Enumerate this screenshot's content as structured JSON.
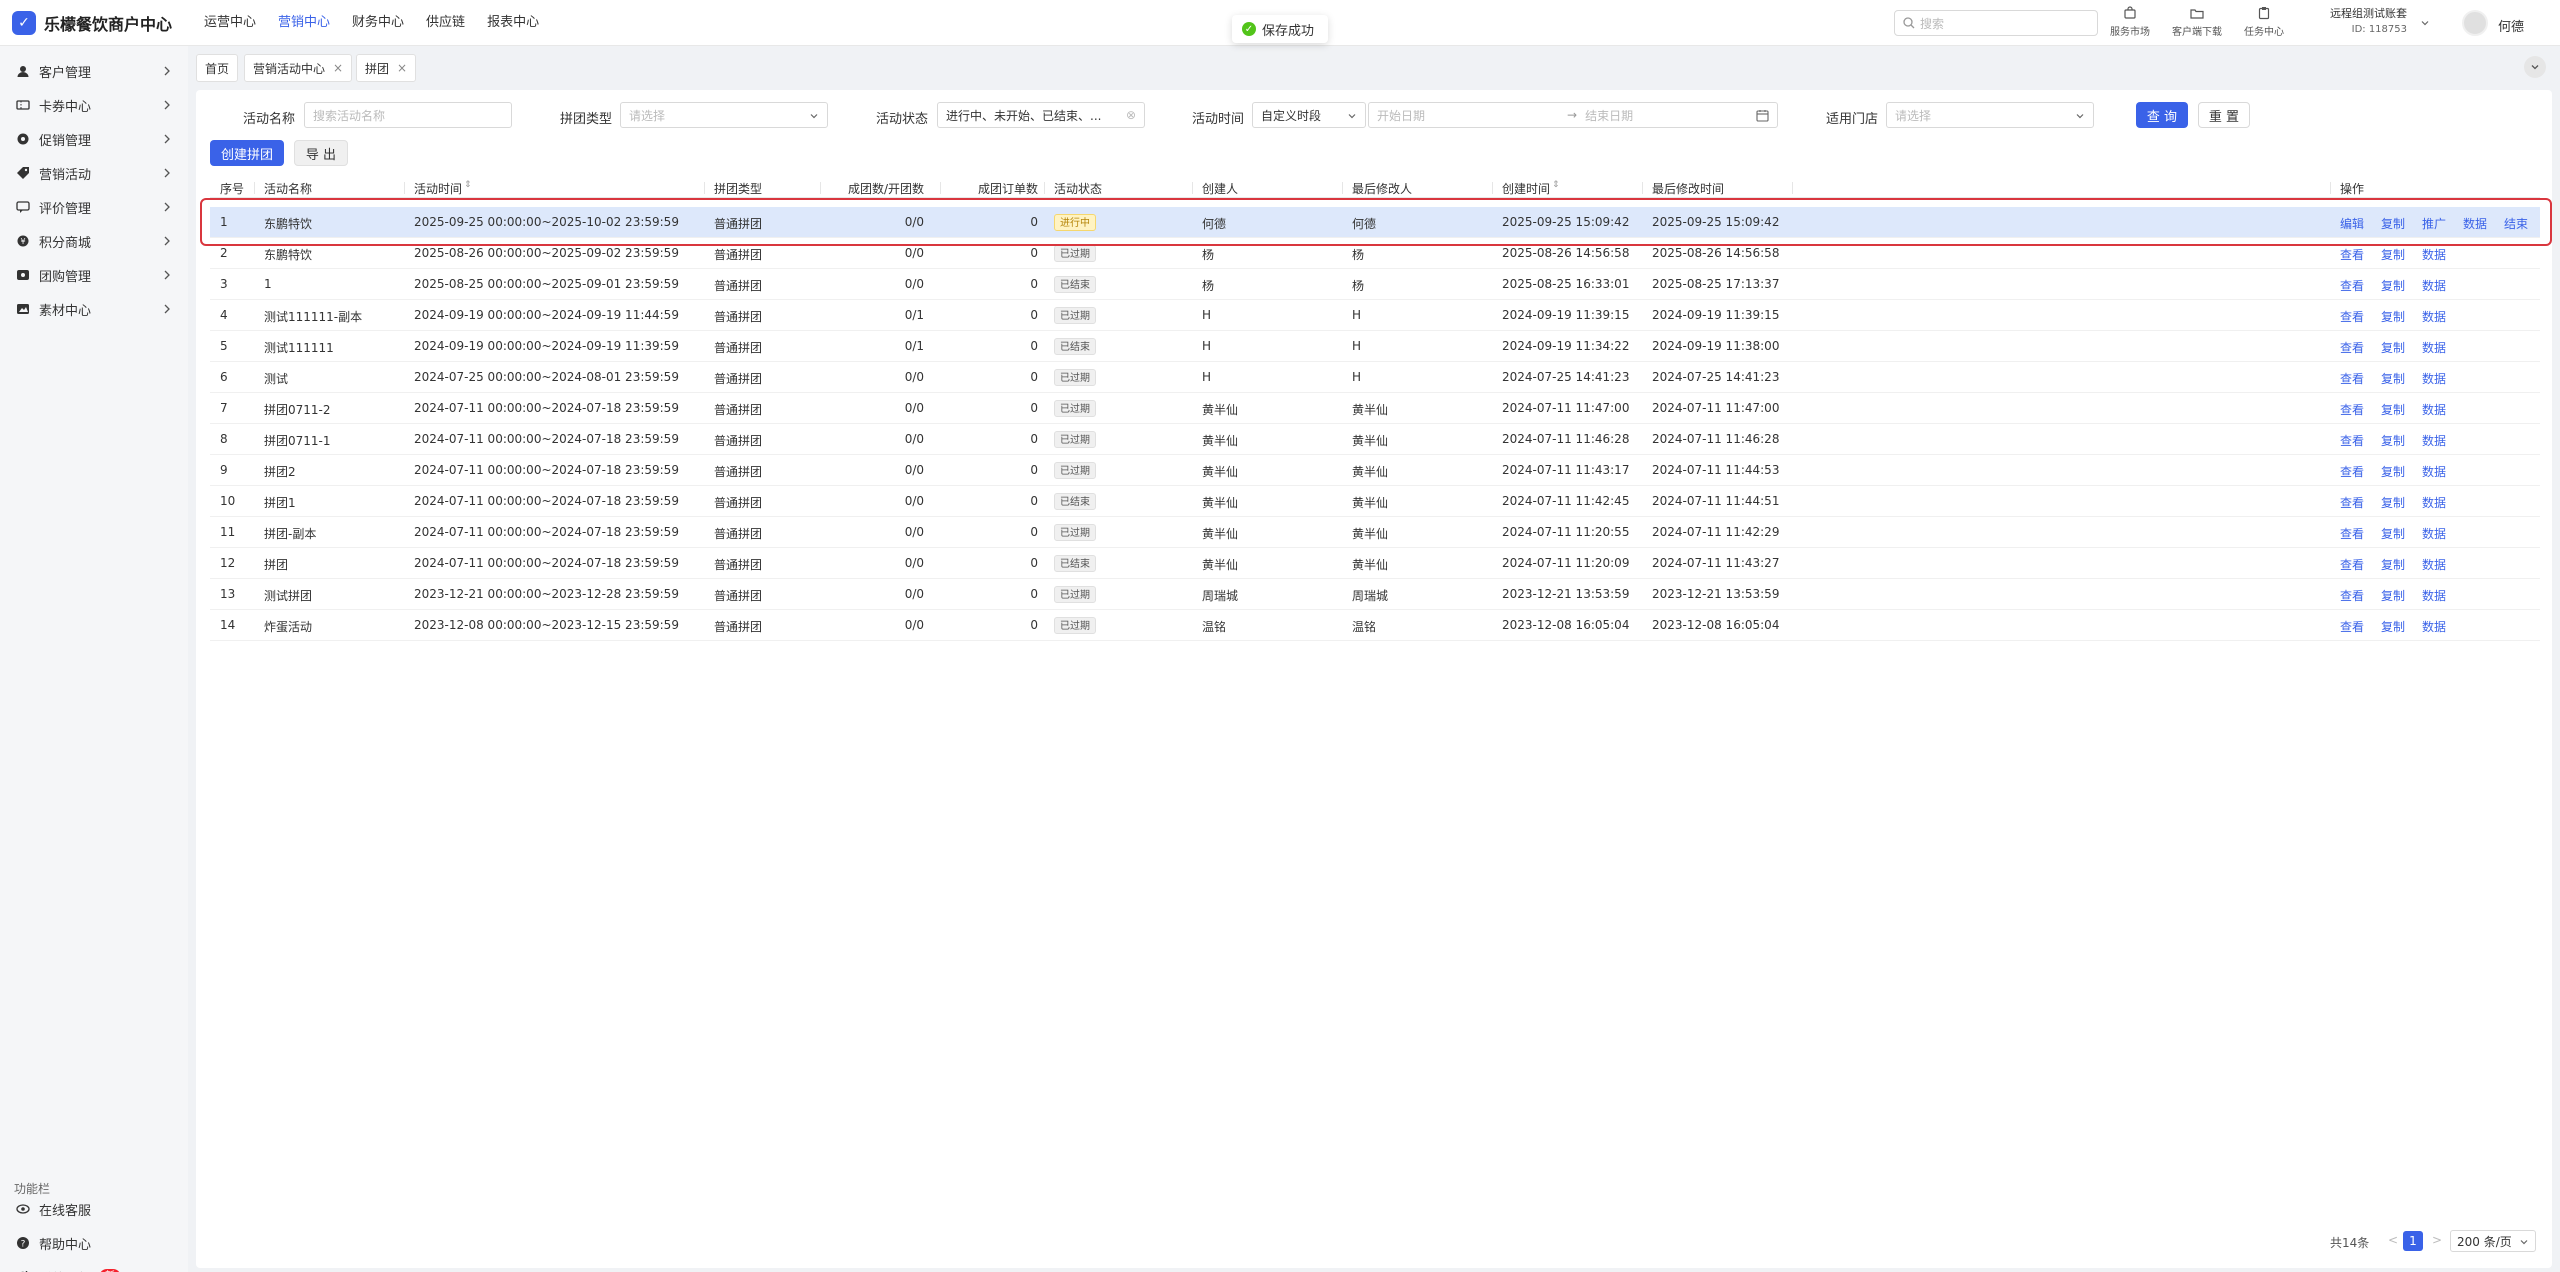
{
  "app": {
    "title": "乐檬餐饮商户中心",
    "logo_char": "✓"
  },
  "topnav": [
    {
      "label": "运营中心",
      "active": false
    },
    {
      "label": "营销中心",
      "active": true
    },
    {
      "label": "财务中心",
      "active": false
    },
    {
      "label": "供应链",
      "active": false
    },
    {
      "label": "报表中心",
      "active": false
    }
  ],
  "toast": {
    "text": "保存成功"
  },
  "search": {
    "placeholder": "搜索"
  },
  "tools": [
    {
      "label": "服务市场",
      "icon": "shop-icon"
    },
    {
      "label": "客户端下载",
      "icon": "folder-icon"
    },
    {
      "label": "任务中心",
      "icon": "clipboard-icon"
    }
  ],
  "account": {
    "name": "远程组测试账套",
    "id": "ID: 118753",
    "user": "何德"
  },
  "sidebar": {
    "items": [
      {
        "label": "客户管理",
        "icon": "user-icon"
      },
      {
        "label": "卡券中心",
        "icon": "ticket-icon"
      },
      {
        "label": "促销管理",
        "icon": "gear-icon"
      },
      {
        "label": "营销活动",
        "icon": "tag-icon"
      },
      {
        "label": "评价管理",
        "icon": "comment-icon"
      },
      {
        "label": "积分商城",
        "icon": "coin-icon"
      },
      {
        "label": "团购管理",
        "icon": "group-icon"
      },
      {
        "label": "素材中心",
        "icon": "image-icon"
      }
    ],
    "func_title": "功能栏",
    "func_items": [
      {
        "label": "在线客服",
        "icon": "eye-icon"
      },
      {
        "label": "帮助中心",
        "icon": "help-icon"
      },
      {
        "label": "系统更新",
        "icon": "refresh-icon",
        "badge": "新"
      }
    ]
  },
  "tabs": [
    {
      "label": "首页",
      "closable": false
    },
    {
      "label": "营销活动中心",
      "closable": true
    },
    {
      "label": "拼团",
      "closable": true
    }
  ],
  "filters": {
    "name_label": "活动名称",
    "name_placeholder": "搜索活动名称",
    "type_label": "拼团类型",
    "type_placeholder": "请选择",
    "status_label": "活动状态",
    "status_value": "进行中、未开始、已结束、...",
    "time_label": "活动时间",
    "time_mode": "自定义时段",
    "start_placeholder": "开始日期",
    "end_placeholder": "结束日期",
    "store_label": "适用门店",
    "store_placeholder": "请选择",
    "query_label": "查 询",
    "reset_label": "重 置"
  },
  "actions": {
    "create_label": "创建拼团",
    "export_label": "导 出"
  },
  "table": {
    "columns": [
      "序号",
      "活动名称",
      "活动时间",
      "拼团类型",
      "成团数/开团数",
      "成团订单数",
      "活动状态",
      "创建人",
      "最后修改人",
      "创建时间",
      "最后修改时间",
      "操作"
    ],
    "rows": [
      {
        "no": "1",
        "name": "东鹏特饮",
        "time": "2025-09-25 00:00:00~2025-10-02 23:59:59",
        "type": "普通拼团",
        "ratio": "0/0",
        "orders": "0",
        "status": "进行中",
        "status_kind": "active",
        "creator": "何德",
        "modifier": "何德",
        "created": "2025-09-25 15:09:42",
        "modified": "2025-09-25 15:09:42",
        "ops": [
          "编辑",
          "复制",
          "推广",
          "数据",
          "结束"
        ],
        "highlight": true
      },
      {
        "no": "2",
        "name": "东鹏特饮",
        "time": "2025-08-26 00:00:00~2025-09-02 23:59:59",
        "type": "普通拼团",
        "ratio": "0/0",
        "orders": "0",
        "status": "已过期",
        "status_kind": "expired",
        "creator": "杨",
        "modifier": "杨",
        "created": "2025-08-26 14:56:58",
        "modified": "2025-08-26 14:56:58",
        "ops": [
          "查看",
          "复制",
          "数据"
        ]
      },
      {
        "no": "3",
        "name": "1",
        "time": "2025-08-25 00:00:00~2025-09-01 23:59:59",
        "type": "普通拼团",
        "ratio": "0/0",
        "orders": "0",
        "status": "已结束",
        "status_kind": "ended",
        "creator": "杨",
        "modifier": "杨",
        "created": "2025-08-25 16:33:01",
        "modified": "2025-08-25 17:13:37",
        "ops": [
          "查看",
          "复制",
          "数据"
        ]
      },
      {
        "no": "4",
        "name": "测试111111-副本",
        "time": "2024-09-19 00:00:00~2024-09-19 11:44:59",
        "type": "普通拼团",
        "ratio": "0/1",
        "orders": "0",
        "status": "已过期",
        "status_kind": "expired",
        "creator": "H",
        "modifier": "H",
        "created": "2024-09-19 11:39:15",
        "modified": "2024-09-19 11:39:15",
        "ops": [
          "查看",
          "复制",
          "数据"
        ]
      },
      {
        "no": "5",
        "name": "测试111111",
        "time": "2024-09-19 00:00:00~2024-09-19 11:39:59",
        "type": "普通拼团",
        "ratio": "0/1",
        "orders": "0",
        "status": "已结束",
        "status_kind": "ended",
        "creator": "H",
        "modifier": "H",
        "created": "2024-09-19 11:34:22",
        "modified": "2024-09-19 11:38:00",
        "ops": [
          "查看",
          "复制",
          "数据"
        ]
      },
      {
        "no": "6",
        "name": "测试",
        "time": "2024-07-25 00:00:00~2024-08-01 23:59:59",
        "type": "普通拼团",
        "ratio": "0/0",
        "orders": "0",
        "status": "已过期",
        "status_kind": "expired",
        "creator": "H",
        "modifier": "H",
        "created": "2024-07-25 14:41:23",
        "modified": "2024-07-25 14:41:23",
        "ops": [
          "查看",
          "复制",
          "数据"
        ]
      },
      {
        "no": "7",
        "name": "拼团0711-2",
        "time": "2024-07-11 00:00:00~2024-07-18 23:59:59",
        "type": "普通拼团",
        "ratio": "0/0",
        "orders": "0",
        "status": "已过期",
        "status_kind": "expired",
        "creator": "黄半仙",
        "modifier": "黄半仙",
        "created": "2024-07-11 11:47:00",
        "modified": "2024-07-11 11:47:00",
        "ops": [
          "查看",
          "复制",
          "数据"
        ]
      },
      {
        "no": "8",
        "name": "拼团0711-1",
        "time": "2024-07-11 00:00:00~2024-07-18 23:59:59",
        "type": "普通拼团",
        "ratio": "0/0",
        "orders": "0",
        "status": "已过期",
        "status_kind": "expired",
        "creator": "黄半仙",
        "modifier": "黄半仙",
        "created": "2024-07-11 11:46:28",
        "modified": "2024-07-11 11:46:28",
        "ops": [
          "查看",
          "复制",
          "数据"
        ]
      },
      {
        "no": "9",
        "name": "拼团2",
        "time": "2024-07-11 00:00:00~2024-07-18 23:59:59",
        "type": "普通拼团",
        "ratio": "0/0",
        "orders": "0",
        "status": "已过期",
        "status_kind": "expired",
        "creator": "黄半仙",
        "modifier": "黄半仙",
        "created": "2024-07-11 11:43:17",
        "modified": "2024-07-11 11:44:53",
        "ops": [
          "查看",
          "复制",
          "数据"
        ]
      },
      {
        "no": "10",
        "name": "拼团1",
        "time": "2024-07-11 00:00:00~2024-07-18 23:59:59",
        "type": "普通拼团",
        "ratio": "0/0",
        "orders": "0",
        "status": "已结束",
        "status_kind": "ended",
        "creator": "黄半仙",
        "modifier": "黄半仙",
        "created": "2024-07-11 11:42:45",
        "modified": "2024-07-11 11:44:51",
        "ops": [
          "查看",
          "复制",
          "数据"
        ]
      },
      {
        "no": "11",
        "name": "拼团-副本",
        "time": "2024-07-11 00:00:00~2024-07-18 23:59:59",
        "type": "普通拼团",
        "ratio": "0/0",
        "orders": "0",
        "status": "已过期",
        "status_kind": "expired",
        "creator": "黄半仙",
        "modifier": "黄半仙",
        "created": "2024-07-11 11:20:55",
        "modified": "2024-07-11 11:42:29",
        "ops": [
          "查看",
          "复制",
          "数据"
        ]
      },
      {
        "no": "12",
        "name": "拼团",
        "time": "2024-07-11 00:00:00~2024-07-18 23:59:59",
        "type": "普通拼团",
        "ratio": "0/0",
        "orders": "0",
        "status": "已结束",
        "status_kind": "ended",
        "creator": "黄半仙",
        "modifier": "黄半仙",
        "created": "2024-07-11 11:20:09",
        "modified": "2024-07-11 11:43:27",
        "ops": [
          "查看",
          "复制",
          "数据"
        ]
      },
      {
        "no": "13",
        "name": "测试拼团",
        "time": "2023-12-21 00:00:00~2023-12-28 23:59:59",
        "type": "普通拼团",
        "ratio": "0/0",
        "orders": "0",
        "status": "已过期",
        "status_kind": "expired",
        "creator": "周瑞城",
        "modifier": "周瑞城",
        "created": "2023-12-21 13:53:59",
        "modified": "2023-12-21 13:53:59",
        "ops": [
          "查看",
          "复制",
          "数据"
        ]
      },
      {
        "no": "14",
        "name": "炸蛋活动",
        "time": "2023-12-08 00:00:00~2023-12-15 23:59:59",
        "type": "普通拼团",
        "ratio": "0/0",
        "orders": "0",
        "status": "已过期",
        "status_kind": "expired",
        "creator": "温铭",
        "modifier": "温铭",
        "created": "2023-12-08 16:05:04",
        "modified": "2023-12-08 16:05:04",
        "ops": [
          "查看",
          "复制",
          "数据"
        ]
      }
    ]
  },
  "pagination": {
    "total": "共14条",
    "current": "1",
    "page_size": "200 条/页",
    "prev": "<",
    "next": ">"
  },
  "colors": {
    "accent": "#3a62e8",
    "highlight_row": "#dde8fb",
    "highlight_border": "#d9363e"
  }
}
